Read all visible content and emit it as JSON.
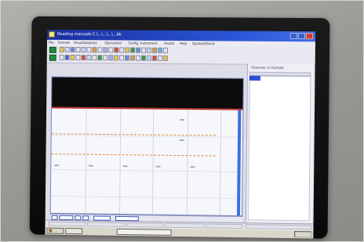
{
  "scene": {
    "description": "photograph of a CRT monitor displaying a Windows data-acquisition application"
  },
  "window": {
    "title": "Reading manuale C:\\...\\...\\...\\...bk",
    "title_color": "#1a2fa0",
    "menu": [
      "File",
      "Formati",
      "Visualizzazione",
      "Operazioni",
      "Config. Instrument",
      "Analisi",
      "Help",
      "Opzioni/Utenti"
    ]
  },
  "side_panel": {
    "header": "Channels vs Formats"
  },
  "colors": {
    "plot_band": "#0c0c0c",
    "trace": "#d98a3a",
    "cursor": "#3d6fe0",
    "accent_red": "#c43a3a"
  },
  "icons": [
    "app-icon",
    "minimize-icon",
    "maximize-icon",
    "close-icon",
    "start-icon"
  ]
}
